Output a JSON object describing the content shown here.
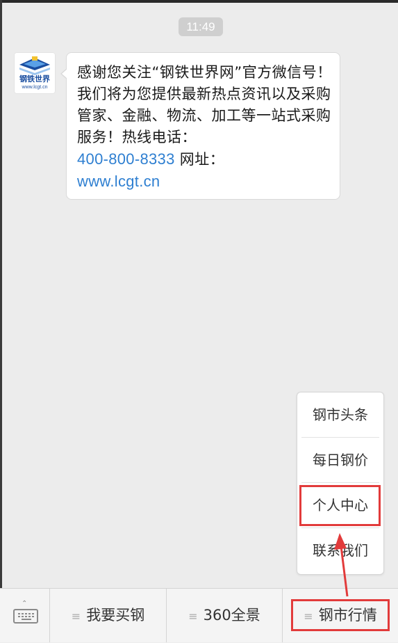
{
  "chat": {
    "time": "11:49",
    "avatar": {
      "brand": "钢铁世界",
      "url": "www.lcgt.cn"
    },
    "message": {
      "text_before": "感谢您关注“钢铁世界网”官方微信号！我们将为您提供最新热点资讯以及采购管家、金融、物流、加工等一站式采购服务！热线电话：",
      "phone": "400-800-8333",
      "mid": " 网址：",
      "website": "www.lcgt.cn"
    }
  },
  "submenu": {
    "items": [
      {
        "label": "钢市头条"
      },
      {
        "label": "每日钢价"
      },
      {
        "label": "个人中心"
      },
      {
        "label": "联系我们"
      }
    ]
  },
  "bottom_menu": {
    "items": [
      {
        "label": "我要买钢"
      },
      {
        "label": "360全景"
      },
      {
        "label": "钢市行情"
      }
    ]
  },
  "colors": {
    "highlight": "#e23b3b",
    "link": "#2e7fd1",
    "background": "#ececec"
  },
  "icons": {
    "keyboard": "keyboard-icon",
    "menu": "menu-lines-icon"
  }
}
